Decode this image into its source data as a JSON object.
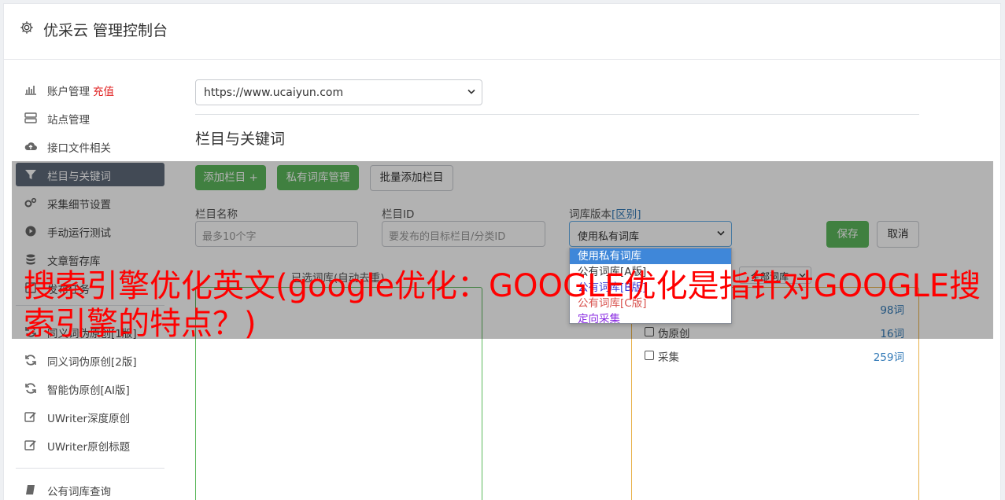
{
  "header": {
    "title": "优采云 管理控制台",
    "icon": "gear-icon"
  },
  "sidebar": {
    "items": [
      {
        "label": "账户管理",
        "badge": "充值",
        "icon": "bar-chart-icon"
      },
      {
        "label": "站点管理",
        "icon": "server-icon"
      },
      {
        "label": "接口文件相关",
        "icon": "cloud-upload-icon"
      },
      {
        "label": "栏目与关键词",
        "icon": "filter-icon",
        "active": true
      },
      {
        "label": "采集细节设置",
        "icon": "gears-icon"
      },
      {
        "label": "手动运行测试",
        "icon": "play-circle-icon"
      },
      {
        "label": "文章暂存库",
        "icon": "database-icon"
      },
      {
        "label": "发布任务",
        "icon": "task-icon"
      },
      {
        "label": "同义词伪原创[1版]",
        "icon": "refresh-icon"
      },
      {
        "label": "同义词伪原创[2版]",
        "icon": "refresh-icon"
      },
      {
        "label": "智能伪原创[AI版]",
        "icon": "refresh-icon"
      },
      {
        "label": "UWriter深度原创",
        "icon": "edit-icon"
      },
      {
        "label": "UWriter原创标题",
        "icon": "edit-icon"
      },
      {
        "label": "公有词库查询",
        "icon": "book-icon"
      }
    ]
  },
  "site_select": {
    "value": "https://www.ucaiyun.com"
  },
  "section_title": "栏目与关键词",
  "toolbar": {
    "add_column": "添加栏目 +",
    "private_lib": "私有词库管理",
    "batch_add": "批量添加栏目"
  },
  "form": {
    "name_label": "栏目名称",
    "name_placeholder": "最多10个字",
    "id_label": "栏目ID",
    "id_placeholder": "要发布的目标栏目/分类ID",
    "lib_label": "词库版本",
    "lib_link": "[区别]",
    "lib_value": "使用私有词库",
    "save": "保存",
    "cancel": "取消"
  },
  "dropdown": {
    "options": [
      {
        "label": "使用私有词库",
        "color": "#ffffff",
        "selected": true
      },
      {
        "label": "公有词库[A版]",
        "color": "#333333"
      },
      {
        "label": "公有词库[B版]",
        "color": "#3b3bd6"
      },
      {
        "label": "公有词库[C版]",
        "color": "#d9534f"
      },
      {
        "label": "定向采集",
        "color": "#8a2be2"
      }
    ]
  },
  "left_panel": {
    "title": "已选词库(自动去重)"
  },
  "right_panel": {
    "filter_value": "全部词库",
    "rows": [
      {
        "label": "",
        "count": "98词"
      },
      {
        "label": "伪原创",
        "count": "16词"
      },
      {
        "label": "采集",
        "count": "259词"
      }
    ]
  },
  "headline": "搜索引擎优化英文(google优化：GOOGLE优化是指针对GOOGLE搜索引擎的特点？)",
  "colors": {
    "accent": "#5cb85c",
    "active_nav": "#5f6a7a",
    "link": "#337ab7",
    "headline": "#ff0000"
  }
}
